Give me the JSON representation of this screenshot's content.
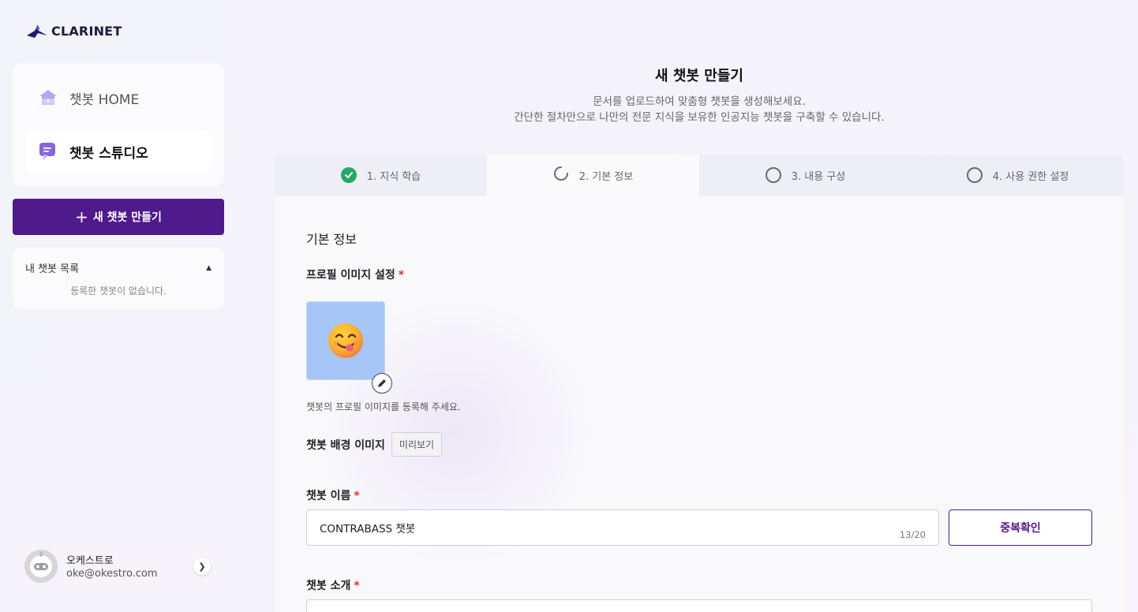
{
  "brand": {
    "name": "CLARINET",
    "accent": "#4f1a8c"
  },
  "sidebar": {
    "nav": [
      {
        "label": "챗봇 HOME",
        "icon": "home-icon",
        "active": false
      },
      {
        "label": "챗봇 스튜디오",
        "icon": "chat-studio-icon",
        "active": true
      }
    ],
    "new_button": {
      "label": "새 챗봇 만들기",
      "icon": "plus-icon"
    },
    "my_list": {
      "title": "내 챗봇 목록",
      "empty_text": "등록한 챗봇이 없습니다.",
      "expanded": true
    },
    "user": {
      "name": "오케스트로",
      "email": "oke@okestro.com"
    }
  },
  "page": {
    "title": "새 챗봇 만들기",
    "description_lines": [
      "문서를 업로드하여 맞춤형 챗봇을 생성해보세요.",
      "간단한 절차만으로 나만의 전문 지식을 보유한 인공지능 챗봇을 구축할 수 있습니다."
    ]
  },
  "steps": [
    {
      "label": "1. 지식 학습",
      "status": "done"
    },
    {
      "label": "2. 기본 정보",
      "status": "in-progress"
    },
    {
      "label": "3. 내용 구성",
      "status": "pending"
    },
    {
      "label": "4. 사용 권한 설정",
      "status": "pending"
    }
  ],
  "form": {
    "section_title": "기본 정보",
    "profile": {
      "label": "프로필 이미지 설정",
      "required_mark": "*",
      "help": "챗봇의 프로필 이미지를 등록해 주세요.",
      "emoji": "😋",
      "background_color": "#a5c6f6"
    },
    "background": {
      "label": "챗봇 배경 이미지",
      "preview_button": "미리보기"
    },
    "name": {
      "label": "챗봇 이름",
      "required_mark": "*",
      "value": "CONTRABASS 챗봇",
      "counter": "13/20",
      "check_button": "중복확인"
    },
    "intro": {
      "label": "챗봇 소개",
      "required_mark": "*"
    }
  }
}
